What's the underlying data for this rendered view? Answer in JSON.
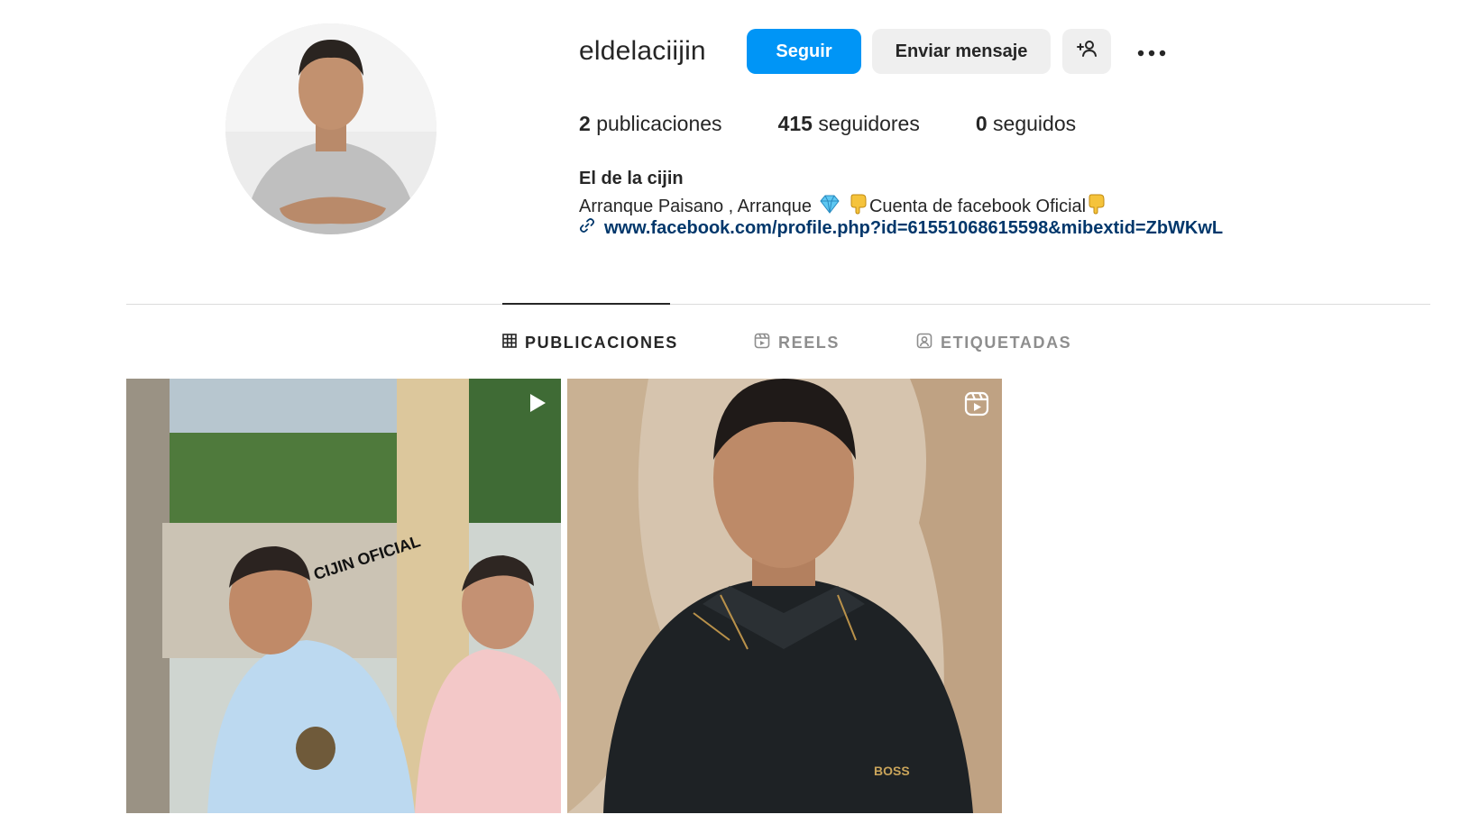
{
  "profile": {
    "username": "eldelaciijin",
    "follow_label": "Seguir",
    "message_label": "Enviar mensaje",
    "suggest_icon": "add-person-icon",
    "more_icon": "more-options-icon",
    "stats": {
      "posts_count": "2",
      "posts_label": "publicaciones",
      "followers_count": "415",
      "followers_label": "seguidores",
      "following_count": "0",
      "following_label": "seguidos"
    },
    "full_name": "El de la cijin",
    "bio_part1": "Arranque Paisano , Arranque",
    "bio_part2": "Cuenta de facebook Oficial",
    "link_icon": "link-icon",
    "link_text": "www.facebook.com/profile.php?id=61551068615598&mibextid=ZbWKwL"
  },
  "tabs": [
    {
      "label": "PUBLICACIONES",
      "icon": "grid-icon",
      "active": true
    },
    {
      "label": "REELS",
      "icon": "reels-icon",
      "active": false
    },
    {
      "label": "ETIQUETADAS",
      "icon": "tagged-icon",
      "active": false
    }
  ],
  "posts": [
    {
      "badge_icon": "video-play-icon",
      "overlay_text": "CIJIN OFICIAL"
    },
    {
      "badge_icon": "reel-icon",
      "overlay_text": "BOSS"
    }
  ],
  "colors": {
    "accent": "#0095f6",
    "link": "#00376b",
    "muted": "#8e8e8e",
    "button_bg": "#efefef"
  }
}
